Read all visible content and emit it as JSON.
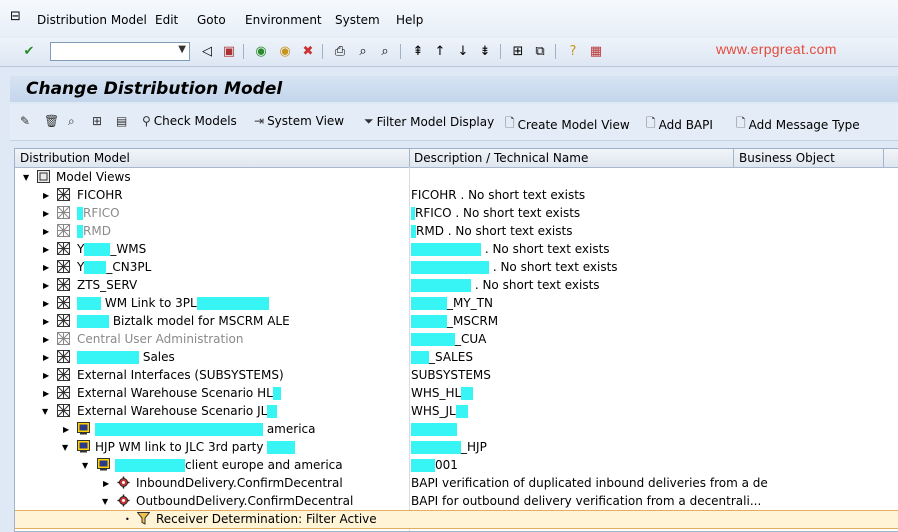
{
  "menu": [
    {
      "label": "Distribution Model"
    },
    {
      "label": "Edit"
    },
    {
      "label": "Goto"
    },
    {
      "label": "Environment"
    },
    {
      "label": "System"
    },
    {
      "label": "Help"
    }
  ],
  "watermark": "www.erpgreat.com",
  "title": "Change Distribution Model",
  "app_toolbar": {
    "check_models": "Check Models",
    "system_view": "System View",
    "filter_model_display": "Filter Model Display",
    "create_model_view": "Create Model View",
    "add_bapi": "Add BAPI",
    "add_message_type": "Add Message Type"
  },
  "tree": {
    "columns": [
      "Distribution Model",
      "Description / Technical Name",
      "Business Object"
    ],
    "rows": [
      {
        "label": "Model Views",
        "desc": ""
      },
      {
        "label": "FICOHR",
        "desc": "FICOHR    . No short text exists"
      },
      {
        "label": "RFICO",
        "desc": "RFICO    . No short text exists"
      },
      {
        "label": "RMD",
        "desc": "RMD    . No short text exists"
      },
      {
        "label": "_WMS",
        "desc": ". No short text exists"
      },
      {
        "label": "_CN3PL",
        "desc": ". No short text exists"
      },
      {
        "label": "ZTS_SERV",
        "desc": ". No short text exists"
      },
      {
        "label": "WM Link to 3PL",
        "desc": "_MY_TN"
      },
      {
        "label": "Biztalk model for MSCRM ALE",
        "desc": "_MSCRM"
      },
      {
        "label": "Central User Administration",
        "desc": "_CUA"
      },
      {
        "label": "Sales",
        "desc": "_SALES"
      },
      {
        "label": "External Interfaces (SUBSYSTEMS)",
        "desc": "SUBSYSTEMS"
      },
      {
        "label": "External Warehouse Scenario HL",
        "desc": "WHS_HL"
      },
      {
        "label": "External Warehouse Scenario JL",
        "desc": "WHS_JL"
      },
      {
        "label": "america",
        "desc": ""
      },
      {
        "label": "HJP WM link to JLC 3rd party",
        "desc": "_HJP"
      },
      {
        "label": "client europe and america",
        "desc": "001"
      },
      {
        "label": "InboundDelivery.ConfirmDecentral",
        "desc": "BAPI verification of duplicated inbound deliveries from a de"
      },
      {
        "label": "OutboundDelivery.ConfirmDecentral",
        "desc": "BAPI for outbound delivery verification from a decentrali..."
      },
      {
        "label": "Receiver Determination: Filter Active",
        "desc": ""
      }
    ]
  }
}
